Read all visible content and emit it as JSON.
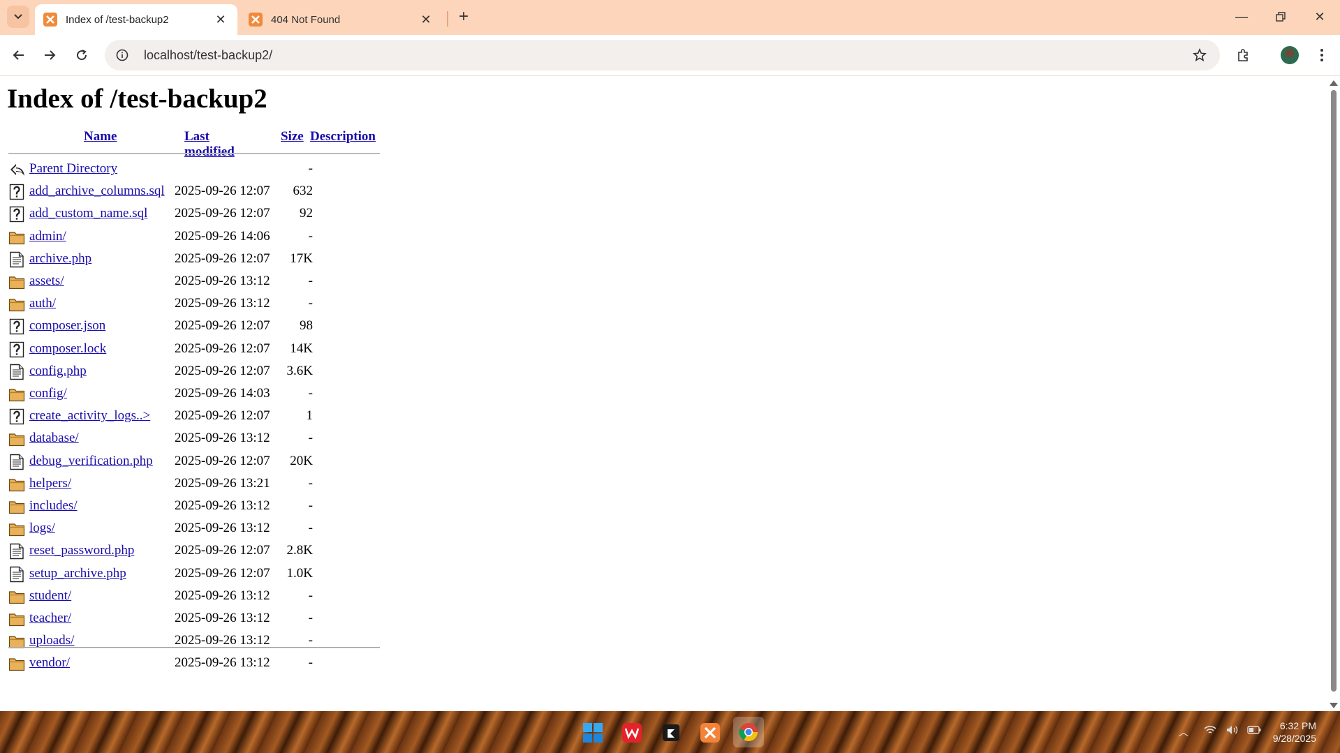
{
  "browser": {
    "tabs": [
      {
        "title": "Index of /test-backup2",
        "active": true
      },
      {
        "title": "404 Not Found",
        "active": false
      }
    ],
    "url": "localhost/test-backup2/"
  },
  "page": {
    "title": "Index of /test-backup2",
    "columns": {
      "name": "Name",
      "modified": "Last modified",
      "size": "Size",
      "description": "Description"
    },
    "rows": [
      {
        "name": "Parent Directory",
        "date": "",
        "size": "-",
        "type": "parent"
      },
      {
        "name": "add_archive_columns.sql",
        "date": "2025-09-26 12:07",
        "size": "632",
        "type": "unknown"
      },
      {
        "name": "add_custom_name.sql",
        "date": "2025-09-26 12:07",
        "size": "92",
        "type": "unknown"
      },
      {
        "name": "admin/",
        "date": "2025-09-26 14:06",
        "size": "-",
        "type": "folder"
      },
      {
        "name": "archive.php",
        "date": "2025-09-26 12:07",
        "size": "17K",
        "type": "text"
      },
      {
        "name": "assets/",
        "date": "2025-09-26 13:12",
        "size": "-",
        "type": "folder"
      },
      {
        "name": "auth/",
        "date": "2025-09-26 13:12",
        "size": "-",
        "type": "folder"
      },
      {
        "name": "composer.json",
        "date": "2025-09-26 12:07",
        "size": "98",
        "type": "unknown"
      },
      {
        "name": "composer.lock",
        "date": "2025-09-26 12:07",
        "size": "14K",
        "type": "unknown"
      },
      {
        "name": "config.php",
        "date": "2025-09-26 12:07",
        "size": "3.6K",
        "type": "text"
      },
      {
        "name": "config/",
        "date": "2025-09-26 14:03",
        "size": "-",
        "type": "folder"
      },
      {
        "name": "create_activity_logs..>",
        "date": "2025-09-26 12:07",
        "size": "1",
        "type": "unknown"
      },
      {
        "name": "database/",
        "date": "2025-09-26 13:12",
        "size": "-",
        "type": "folder"
      },
      {
        "name": "debug_verification.php",
        "date": "2025-09-26 12:07",
        "size": "20K",
        "type": "text"
      },
      {
        "name": "helpers/",
        "date": "2025-09-26 13:21",
        "size": "-",
        "type": "folder"
      },
      {
        "name": "includes/",
        "date": "2025-09-26 13:12",
        "size": "-",
        "type": "folder"
      },
      {
        "name": "logs/",
        "date": "2025-09-26 13:12",
        "size": "-",
        "type": "folder"
      },
      {
        "name": "reset_password.php",
        "date": "2025-09-26 12:07",
        "size": "2.8K",
        "type": "text"
      },
      {
        "name": "setup_archive.php",
        "date": "2025-09-26 12:07",
        "size": "1.0K",
        "type": "text"
      },
      {
        "name": "student/",
        "date": "2025-09-26 13:12",
        "size": "-",
        "type": "folder"
      },
      {
        "name": "teacher/",
        "date": "2025-09-26 13:12",
        "size": "-",
        "type": "folder"
      },
      {
        "name": "uploads/",
        "date": "2025-09-26 13:12",
        "size": "-",
        "type": "folder"
      },
      {
        "name": "vendor/",
        "date": "2025-09-26 13:12",
        "size": "-",
        "type": "folder"
      }
    ]
  },
  "taskbar": {
    "apps": [
      "windows-start-icon",
      "wps-office-icon",
      "terminal-icon",
      "xampp-icon",
      "chrome-icon"
    ],
    "time": "6:32 PM",
    "date": "9/28/2025"
  },
  "colors": {
    "tabbar": "#fcd5bb",
    "link": "#1a0dab",
    "folder": "#e8b15a"
  }
}
